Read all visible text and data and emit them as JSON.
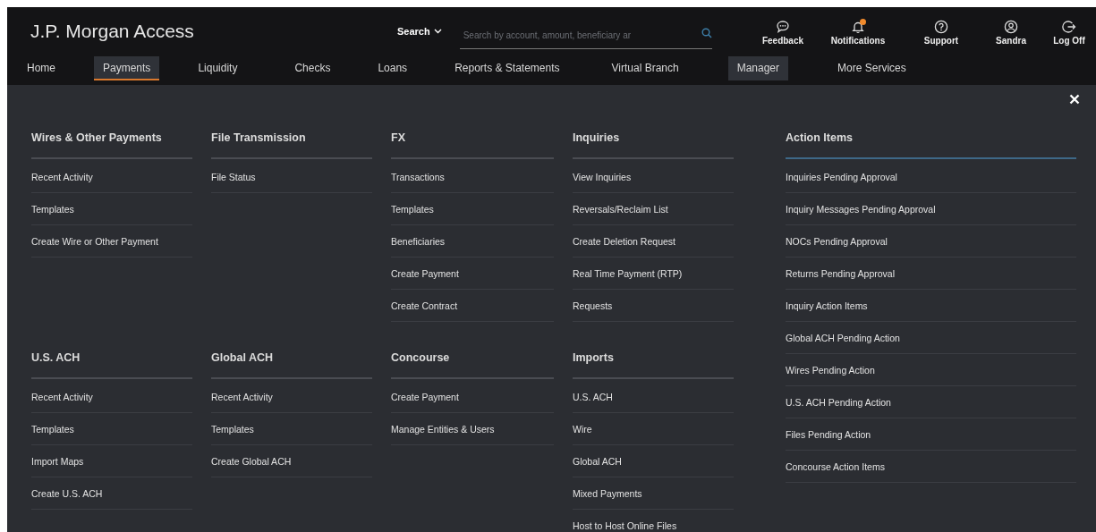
{
  "header": {
    "title": "J.P. Morgan Access",
    "search_scope": "Search",
    "search_placeholder": "Search by account, amount, beneficiary ar",
    "actions": [
      {
        "kind": "feedback",
        "label": "Feedback"
      },
      {
        "kind": "notifications",
        "label": "Notifications",
        "alert": true
      },
      {
        "kind": "support",
        "label": "Support"
      },
      {
        "kind": "user",
        "label": "Sandra"
      },
      {
        "kind": "logoff",
        "label": "Log Off"
      }
    ]
  },
  "nav": [
    {
      "label": "Home",
      "selected": false,
      "highlighted": false
    },
    {
      "label": "Payments",
      "selected": true,
      "highlighted": false
    },
    {
      "label": "Liquidity",
      "selected": false,
      "highlighted": false
    },
    {
      "label": "Checks",
      "selected": false,
      "highlighted": false
    },
    {
      "label": "Loans",
      "selected": false,
      "highlighted": false
    },
    {
      "label": "Reports & Statements",
      "selected": false,
      "highlighted": false
    },
    {
      "label": "Virtual Branch",
      "selected": false,
      "highlighted": false
    },
    {
      "label": "Manager",
      "selected": false,
      "highlighted": true
    },
    {
      "label": "More Services",
      "selected": false,
      "highlighted": false
    }
  ],
  "menu": {
    "columns": [
      [
        {
          "heading": "Wires & Other Payments",
          "accent": false,
          "items": [
            "Recent Activity",
            "Templates",
            "Create Wire or Other Payment"
          ]
        },
        {
          "heading": "U.S. ACH",
          "accent": false,
          "items": [
            "Recent Activity",
            "Templates",
            "Import Maps",
            "Create U.S. ACH"
          ]
        }
      ],
      [
        {
          "heading": "File Transmission",
          "accent": false,
          "items": [
            "File Status"
          ]
        },
        {
          "heading": "Global ACH",
          "accent": false,
          "items": [
            "Recent Activity",
            "Templates",
            "Create Global ACH"
          ]
        }
      ],
      [
        {
          "heading": "FX",
          "accent": false,
          "items": [
            "Transactions",
            "Templates",
            "Beneficiaries",
            "Create Payment",
            "Create Contract"
          ]
        },
        {
          "heading": "Concourse",
          "accent": false,
          "items": [
            "Create Payment",
            "Manage Entities & Users"
          ]
        }
      ],
      [
        {
          "heading": "Inquiries",
          "accent": false,
          "items": [
            "View Inquiries",
            "Reversals/Reclaim List",
            "Create Deletion Request",
            "Real Time Payment (RTP)",
            "Requests"
          ]
        },
        {
          "heading": "Imports",
          "accent": false,
          "items": [
            "U.S. ACH",
            "Wire",
            "Global ACH",
            "Mixed Payments",
            "Host to Host Online Files"
          ]
        }
      ],
      [
        {
          "heading": "Action Items",
          "accent": true,
          "items": [
            "Inquiries Pending Approval",
            "Inquiry Messages Pending Approval",
            "NOCs Pending Approval",
            "Returns Pending Approval",
            "Inquiry Action Items",
            "Global ACH Pending Action",
            "Wires Pending Action",
            "U.S. ACH Pending Action",
            "Files Pending Action",
            "Concourse Action Items"
          ]
        }
      ]
    ]
  }
}
